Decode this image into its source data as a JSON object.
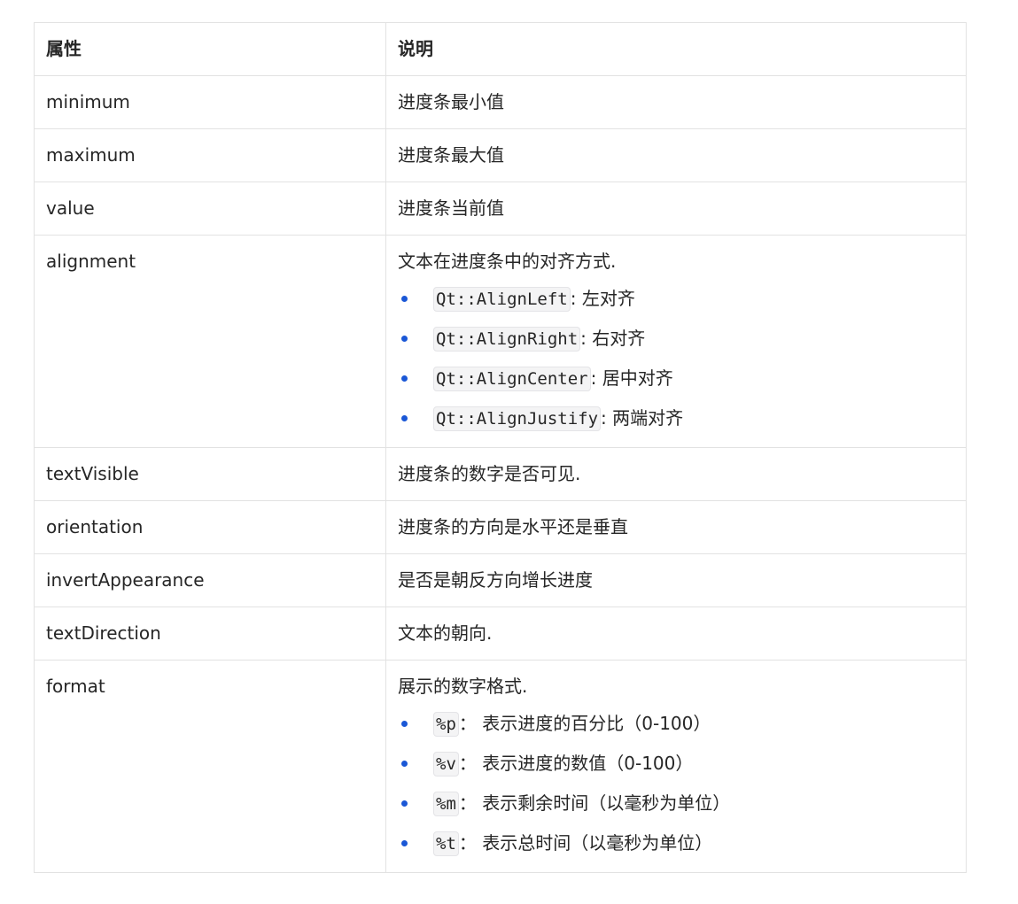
{
  "header": {
    "col_property": "属性",
    "col_description": "说明"
  },
  "rows": [
    {
      "name": "minimum",
      "desc": "进度条最小值"
    },
    {
      "name": "maximum",
      "desc": "进度条最大值"
    },
    {
      "name": "value",
      "desc": "进度条当前值"
    },
    {
      "name": "alignment",
      "desc": "文本在进度条中的对齐方式.",
      "items": [
        {
          "code": "Qt::AlignLeft",
          "text": ": 左对齐"
        },
        {
          "code": "Qt::AlignRight",
          "text": ": 右对齐"
        },
        {
          "code": "Qt::AlignCenter",
          "text": ": 居中对齐"
        },
        {
          "code": "Qt::AlignJustify",
          "text": ": 两端对齐"
        }
      ]
    },
    {
      "name": "textVisible",
      "desc": "进度条的数字是否可见."
    },
    {
      "name": "orientation",
      "desc": "进度条的方向是水平还是垂直"
    },
    {
      "name": "invertAppearance",
      "desc": "是否是朝反方向增长进度"
    },
    {
      "name": "textDirection",
      "desc": "文本的朝向."
    },
    {
      "name": "format",
      "desc": "展示的数字格式.",
      "items": [
        {
          "code": "%p",
          "text": "： 表示进度的百分比（0-100）"
        },
        {
          "code": "%v",
          "text": "： 表示进度的数值（0-100）"
        },
        {
          "code": "%m",
          "text": "： 表示剩余时间（以毫秒为单位）"
        },
        {
          "code": "%t",
          "text": "： 表示总时间（以毫秒为单位）"
        }
      ]
    }
  ],
  "colors": {
    "bullet": "#1a57d6",
    "border": "#e2e2e2",
    "code_bg": "#f4f4f5"
  }
}
